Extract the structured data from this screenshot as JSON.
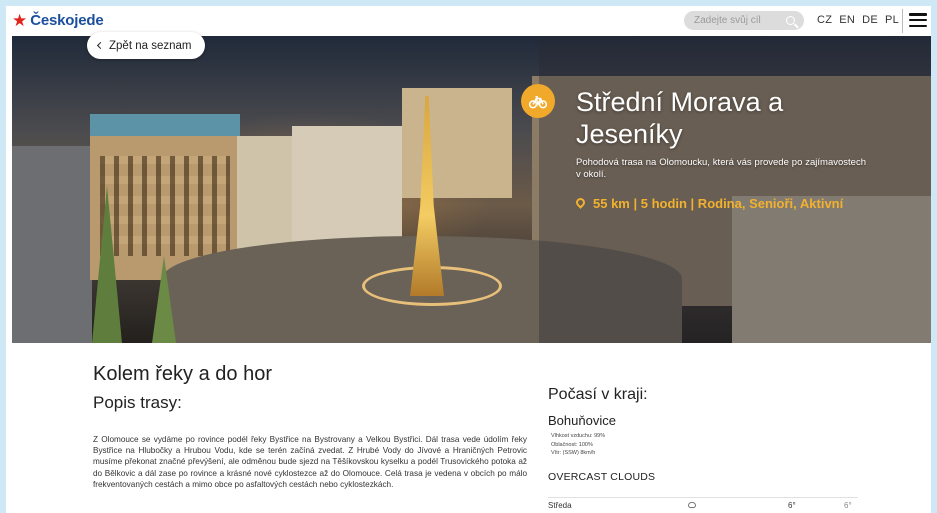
{
  "header": {
    "logo_text": "Českojede",
    "search_placeholder": "Zadejte svůj cíl",
    "languages": [
      "CZ",
      "EN",
      "DE",
      "PL"
    ]
  },
  "hero": {
    "back_label": "Zpět na seznam",
    "title": "Střední Morava a Jeseníky",
    "subtitle": "Pohodová trasa na Olomoucku, která vás provede po zajímavostech v okolí.",
    "stats": "55 km | 5 hodin | Rodina, Senioři, Aktivní",
    "accent_color": "#f2b12e",
    "icon": "bicycle-icon"
  },
  "content": {
    "title": "Kolem řeky a do hor",
    "subtitle": "Popis trasy:",
    "description": "Z Olomouce se vydáme po rovince podél řeky Bystřice na Bystrovany a Velkou Bystřici. Dál trasa vede údolím řeky Bystřice na Hlubočky a Hrubou Vodu, kde se terén začíná zvedat. Z Hrubé Vody do Jívové a Hraničných Petrovic musíme překonat značné převýšení, ale odměnou bude sjezd na Těšíkovskou kyselku a podél Trusovického potoka až do Bělkovic a dál zase po rovince a krásné nové cyklostezce až do Olomouce. Celá trasa je vedena v obcích po málo frekventovaných cestách a mimo obce po asfaltových cestách nebo cyklostezkách."
  },
  "weather": {
    "heading": "Počasí v kraji:",
    "city": "Bohuňovice",
    "humidity": "Vlhkost vzduchu: 99%",
    "clouds": "Oblačnost: 100%",
    "wind": "Vítr: (SSW) 8km/h",
    "condition": "OVERCAST CLOUDS",
    "forecast": [
      {
        "day": "Středa",
        "icon": "cloud-icon",
        "temp_max": "6°",
        "temp_min": "6°"
      }
    ]
  }
}
